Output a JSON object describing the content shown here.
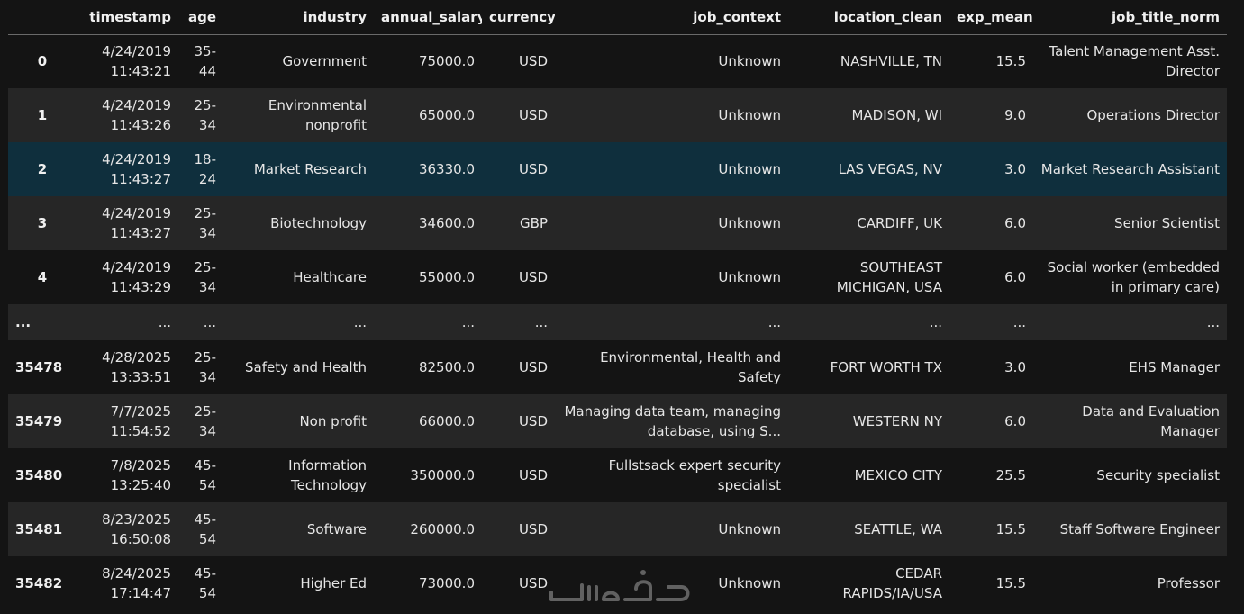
{
  "columns": [
    "",
    "timestamp",
    "age",
    "industry",
    "annual_salary",
    "currency",
    "job_context",
    "location_clean",
    "exp_mean",
    "job_title_norm"
  ],
  "rows": [
    [
      "0",
      "4/24/2019 11:43:21",
      "35-44",
      "Government",
      "75000.0",
      "USD",
      "Unknown",
      "NASHVILLE, TN",
      "15.5",
      "Talent Management Asst. Director"
    ],
    [
      "1",
      "4/24/2019 11:43:26",
      "25-34",
      "Environmental nonprofit",
      "65000.0",
      "USD",
      "Unknown",
      "MADISON, WI",
      "9.0",
      "Operations Director"
    ],
    [
      "2",
      "4/24/2019 11:43:27",
      "18-24",
      "Market Research",
      "36330.0",
      "USD",
      "Unknown",
      "LAS VEGAS, NV",
      "3.0",
      "Market Research Assistant"
    ],
    [
      "3",
      "4/24/2019 11:43:27",
      "25-34",
      "Biotechnology",
      "34600.0",
      "GBP",
      "Unknown",
      "CARDIFF, UK",
      "6.0",
      "Senior Scientist"
    ],
    [
      "4",
      "4/24/2019 11:43:29",
      "25-34",
      "Healthcare",
      "55000.0",
      "USD",
      "Unknown",
      "SOUTHEAST MICHIGAN, USA",
      "6.0",
      "Social worker (embedded in primary care)"
    ],
    [
      "...",
      "...",
      "...",
      "...",
      "...",
      "...",
      "...",
      "...",
      "...",
      "..."
    ],
    [
      "35478",
      "4/28/2025 13:33:51",
      "25-34",
      "Safety and Health",
      "82500.0",
      "USD",
      "Environmental, Health and Safety",
      "FORT WORTH TX",
      "3.0",
      "EHS Manager"
    ],
    [
      "35479",
      "7/7/2025 11:54:52",
      "25-34",
      "Non profit",
      "66000.0",
      "USD",
      "Managing data team, managing database, using S...",
      "WESTERN NY",
      "6.0",
      "Data and Evaluation Manager"
    ],
    [
      "35480",
      "7/8/2025 13:25:40",
      "45-54",
      "Information Technology",
      "350000.0",
      "USD",
      "Fullstsack expert security specialist",
      "MEXICO CITY",
      "25.5",
      "Security specialist"
    ],
    [
      "35481",
      "8/23/2025 16:50:08",
      "45-54",
      "Software",
      "260000.0",
      "USD",
      "Unknown",
      "SEATTLE, WA",
      "15.5",
      "Staff Software Engineer"
    ],
    [
      "35482",
      "8/24/2025 17:14:47",
      "45-54",
      "Higher Ed",
      "73000.0",
      "USD",
      "Unknown",
      "CEDAR RAPIDS/IA/USA",
      "15.5",
      "Professor"
    ]
  ],
  "highlighted_row_index": 2,
  "colors": {
    "background": "#141414",
    "stripe": "#262626",
    "highlight": "#0f2f3d",
    "text": "#e6e6e6",
    "header_rule": "#6a6a6a"
  },
  "watermark_text": "خمسات"
}
